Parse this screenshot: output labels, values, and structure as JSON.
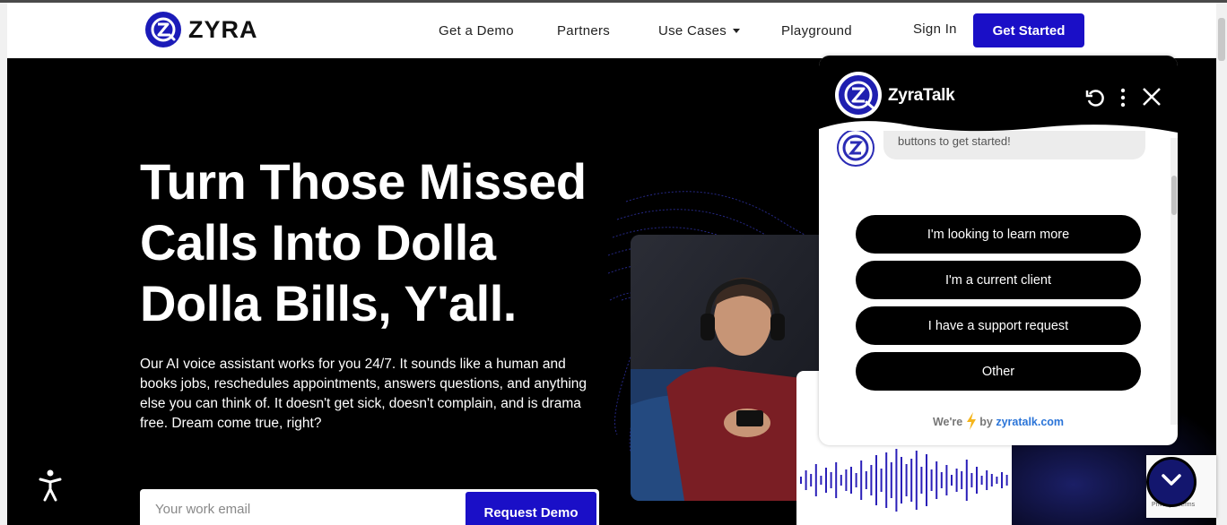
{
  "nav": {
    "brand": "ZYRA",
    "links": [
      "Get a Demo",
      "Partners",
      "Use Cases",
      "Playground"
    ],
    "sign_in": "Sign In",
    "get_started": "Get Started"
  },
  "hero": {
    "headline": [
      "Turn Those Missed",
      "Calls Into Dolla",
      "Dolla Bills, Y'all."
    ],
    "description": "Our AI voice assistant works for you 24/7. It sounds like a human and books jobs, reschedules appointments, answers questions, and anything else you can think of. It doesn't get sick, doesn't complain, and is drama free. Dream come true, right?",
    "email_placeholder": "Your work email",
    "cta": "Request Demo"
  },
  "chat": {
    "title": "ZyraTalk",
    "partial_message": "buttons to get started!",
    "options": [
      "I'm looking to learn more",
      "I'm a current client",
      "I have a support request",
      "Other"
    ],
    "powered_prefix": "We're",
    "powered_by": "by",
    "powered_brand": "zyratalk.com"
  },
  "recaptcha": {
    "text": "Privacy - Terms"
  },
  "colors": {
    "accent": "#1a0fc7",
    "hero_bg": "#000000",
    "chat_header": "#000000"
  },
  "icons": [
    "accessibility-icon",
    "refresh-icon",
    "more-vertical-icon",
    "close-icon",
    "chevron-down-icon",
    "lightning-icon"
  ]
}
